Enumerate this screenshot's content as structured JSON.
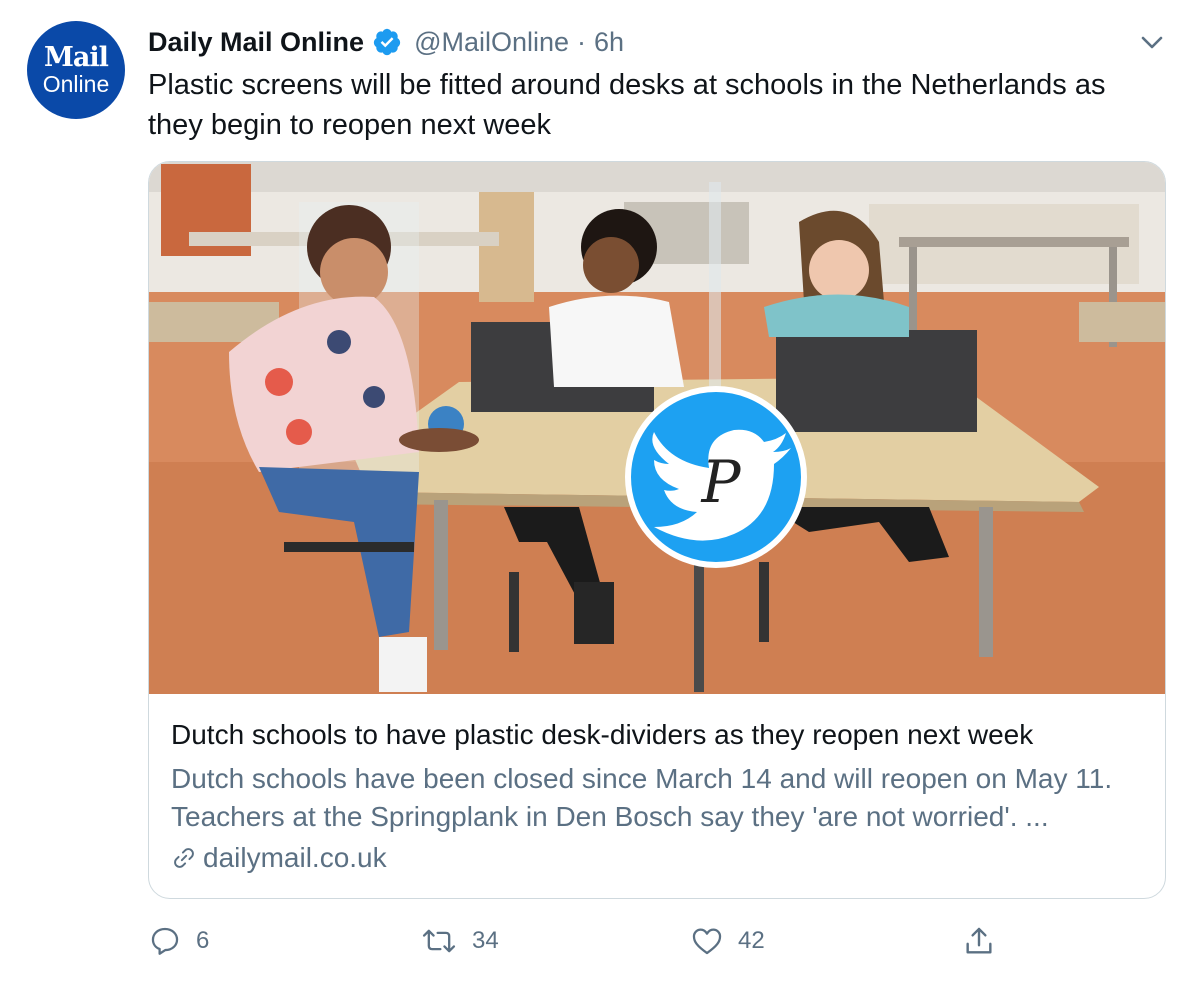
{
  "tweet": {
    "author": {
      "avatar_line1": "Mail",
      "avatar_line2": "Online",
      "name": "Daily Mail Online",
      "verified": true,
      "handle": "@MailOnline",
      "separator": "·",
      "time": "6h"
    },
    "text": "Plastic screens will be fitted around desks at schools in the Netherlands as they begin to reopen next week",
    "card": {
      "title": "Dutch schools to have plastic desk-dividers as they reopen next week",
      "description": "Dutch schools have been closed since March 14 and will reopen on May 11. Teachers at the Springplank in Den Bosch say they 'are not worried'. ...",
      "domain": "dailymail.co.uk",
      "overlay_logo_letter": "P"
    },
    "actions": {
      "replies": "6",
      "retweets": "34",
      "likes": "42"
    }
  },
  "colors": {
    "brand_blue": "#0a49a8",
    "verified_blue": "#1d9bf0",
    "secondary_text": "#5b7083",
    "twitter_blue": "#1da1f2"
  },
  "icons": [
    "verified-icon",
    "chevron-down-icon",
    "link-icon",
    "reply-icon",
    "retweet-icon",
    "like-icon",
    "share-icon",
    "twitter-bird-icon"
  ]
}
